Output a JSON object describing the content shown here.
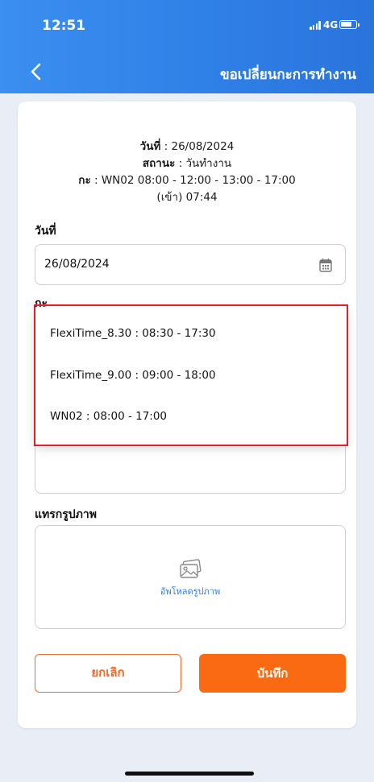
{
  "status_bar": {
    "time": "12:51",
    "network": "4G"
  },
  "nav": {
    "title": "ขอเปลี่ยนกะการทำงาน"
  },
  "info": {
    "date_label": "วันที่",
    "date_value": " : 26/08/2024",
    "status_label": "สถานะ",
    "status_value": " : วันทำงาน",
    "shift_label": "กะ",
    "shift_value": " : WN02 08:00 - 12:00 - 13:00 - 17:00",
    "checkin": "(เข้า) 07:44"
  },
  "form": {
    "date_label": "วันที่",
    "date_value": "26/08/2024",
    "shift_label": "กะ",
    "image_label": "แทรกรูปภาพ",
    "upload_text": "อัพโหลดรูปภาพ"
  },
  "dropdown": {
    "options": [
      "FlexiTime_8.30 : 08:30 - 17:30",
      "FlexiTime_9.00 : 09:00 - 18:00",
      "WN02 : 08:00 - 17:00"
    ]
  },
  "buttons": {
    "cancel": "ยกเลิก",
    "save": "บันทึก"
  },
  "colors": {
    "header": "#2f7fe6",
    "accent": "#fa6a12",
    "highlight": "#e0202a"
  }
}
